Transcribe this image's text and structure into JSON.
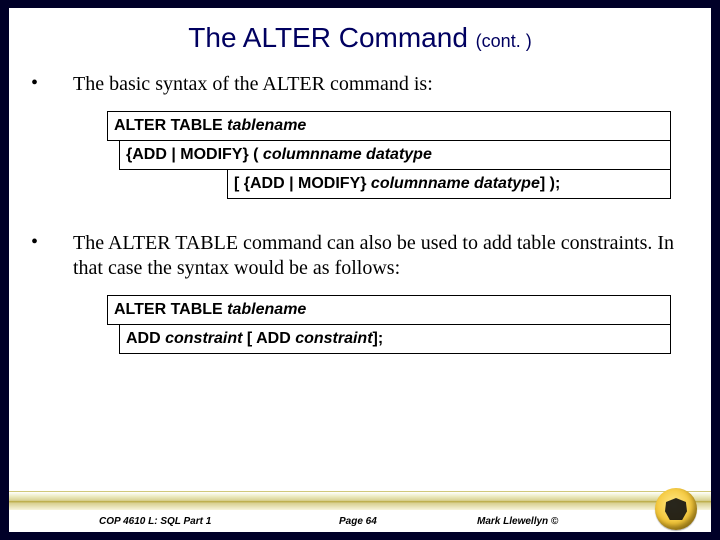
{
  "title": {
    "main": "The ALTER Command ",
    "sub": "(cont. )"
  },
  "bullets": {
    "b1": "The basic syntax of the ALTER command is:",
    "b2": "The ALTER TABLE command can also be used to add table constraints.  In that case the syntax would be as follows:"
  },
  "syntax": {
    "box1": {
      "pre": "ALTER TABLE  ",
      "ital": "tablename"
    },
    "box2": {
      "pre": " {ADD | MODIFY} ( ",
      "ital": "columnname  datatype"
    },
    "box3": {
      "pre": "[ {ADD | MODIFY} ",
      "ital": "columnname  datatype",
      "post": "] );"
    },
    "box4": {
      "pre": "ALTER TABLE  ",
      "ital": "tablename"
    },
    "box5": {
      "pre": " ADD  ",
      "ital1": "constraint",
      "mid": "   [ ADD ",
      "ital2": "constraint",
      "post": "];"
    }
  },
  "footer": {
    "left": "COP 4610 L: SQL Part 1",
    "center": "Page 64",
    "right": "Mark Llewellyn ©"
  }
}
